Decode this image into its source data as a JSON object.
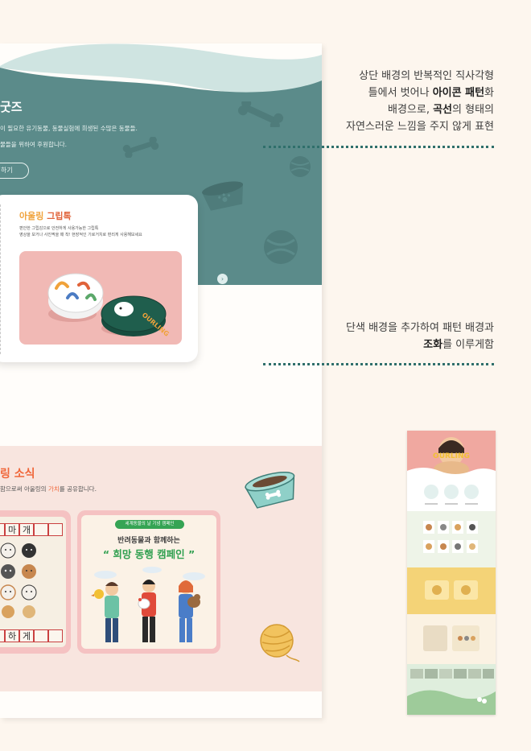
{
  "goods": {
    "title": "굿즈",
    "desc_line1": "이 필요한 유기동물, 동물실험에 희생된 수많은 동물들.",
    "desc_line2": "물들을 위하여 후원합니다.",
    "button_label": "하기"
  },
  "card": {
    "title_part1": "아울링",
    "title_part2": "그립톡",
    "desc_line1": "편안한 그립감으로 안전하게 사용가능한 그립톡",
    "desc_line2": "영상을 보거나 사진찍을 때 착! 현장적인 기로거치로 편리게 사용해보세요",
    "next_label": "›"
  },
  "news": {
    "title": "링 소식",
    "desc_prefix": "함으로써 아울링의 ",
    "desc_highlight": "가치",
    "desc_suffix": "를 공유합니다.",
    "grid_top": [
      "마",
      "개"
    ],
    "grid_bottom": [
      "하",
      "게"
    ],
    "campaign": {
      "badge": "세계동물의 날 기념 캠페인",
      "subtitle": "반려동물과 함께하는",
      "title": "“ 희망 동행 캠페인 ”"
    }
  },
  "annotations": [
    {
      "lines": [
        [
          {
            "t": "상단 배경의 반복적인 직사각형"
          }
        ],
        [
          {
            "t": "틀에서 벗어나 "
          },
          {
            "t": "아이콘 패턴",
            "b": true
          },
          {
            "t": "화"
          }
        ],
        [
          {
            "t": "배경으로, "
          },
          {
            "t": "곡선",
            "b": true
          },
          {
            "t": "의 형태의"
          }
        ],
        [
          {
            "t": "자연스러운 느낌을 주지 않게 표현"
          }
        ]
      ]
    },
    {
      "lines": [
        [
          {
            "t": "단색 배경을 추가하여 패턴 배경과"
          }
        ],
        [
          {
            "t": "조화",
            "b": true
          },
          {
            "t": "를 이루게함"
          }
        ]
      ]
    }
  ],
  "colors": {
    "page_bg": "#fdf6ee",
    "teal": "#5b8b8a",
    "teal_light": "#cfe4e1",
    "accent_orange": "#f0673a",
    "campaign_green": "#35a454",
    "dots": "#2f6f6b"
  },
  "icons": [
    "bone-icon",
    "ball-icon",
    "pet-bowl-icon",
    "yarn-ball-icon",
    "chevron-right-icon"
  ]
}
